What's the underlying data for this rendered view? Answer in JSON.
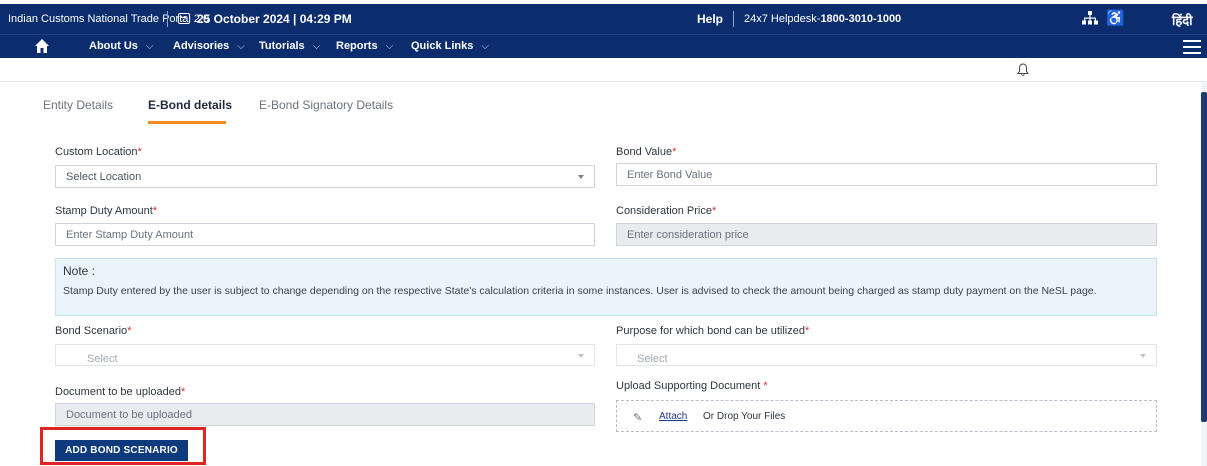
{
  "topbar": {
    "portal_name": "Indian Customs National Trade Portal 2.0",
    "datetime": "25 October 2024 | 04:29 PM",
    "help": "Help",
    "helpdesk_prefix": "24x7 Helpdesk-",
    "helpdesk_number": "1800-3010-1000",
    "language": "हिंदी",
    "icons": [
      "calendar-icon",
      "sitemap-icon",
      "accessibility-icon"
    ]
  },
  "nav": {
    "items": [
      {
        "label": "About Us"
      },
      {
        "label": "Advisories"
      },
      {
        "label": "Tutorials"
      },
      {
        "label": "Reports"
      },
      {
        "label": "Quick Links"
      }
    ],
    "icons": [
      "home-icon",
      "hamburger-menu-icon",
      "bell-icon"
    ]
  },
  "tabs": [
    {
      "label": "Entity Details",
      "active": false
    },
    {
      "label": "E-Bond details",
      "active": true
    },
    {
      "label": "E-Bond Signatory Details",
      "active": false
    }
  ],
  "form": {
    "custom_location": {
      "label": "Custom Location",
      "required": "*",
      "value": "Select Location"
    },
    "bond_value": {
      "label": "Bond Value",
      "required": "*",
      "placeholder": "Enter Bond Value"
    },
    "stamp_duty": {
      "label": "Stamp Duty Amount",
      "required": "*",
      "placeholder": "Enter Stamp Duty Amount"
    },
    "consideration_price": {
      "label": "Consideration Price",
      "required": "*",
      "placeholder": "Enter consideration price"
    },
    "bond_scenario": {
      "label": "Bond Scenario",
      "required": "*",
      "value": "Select"
    },
    "purpose": {
      "label": "Purpose for which bond can be utilized",
      "required": "*",
      "value": "Select"
    },
    "document": {
      "label": "Document to be uploaded",
      "required": "*",
      "placeholder": "Document to be uploaded"
    },
    "supporting_doc": {
      "label": "Upload Supporting Document ",
      "required": "*",
      "attach": "Attach",
      "drop": "Or Drop Your Files"
    }
  },
  "note": {
    "title": "Note :",
    "text": "Stamp Duty entered by the user is subject to change depending on the respective State's calculation criteria in some instances. User is advised to check the amount being charged as stamp duty payment on the NeSL page."
  },
  "actions": {
    "add_bond_scenario": "ADD BOND SCENARIO"
  },
  "colors": {
    "header_bg": "#0b2d6e",
    "tab_accent": "#f28c1f",
    "required": "#d32f2f",
    "button_bg": "#0c3a7c",
    "highlight": "#e02424",
    "note_bg": "#eaf4fb"
  }
}
